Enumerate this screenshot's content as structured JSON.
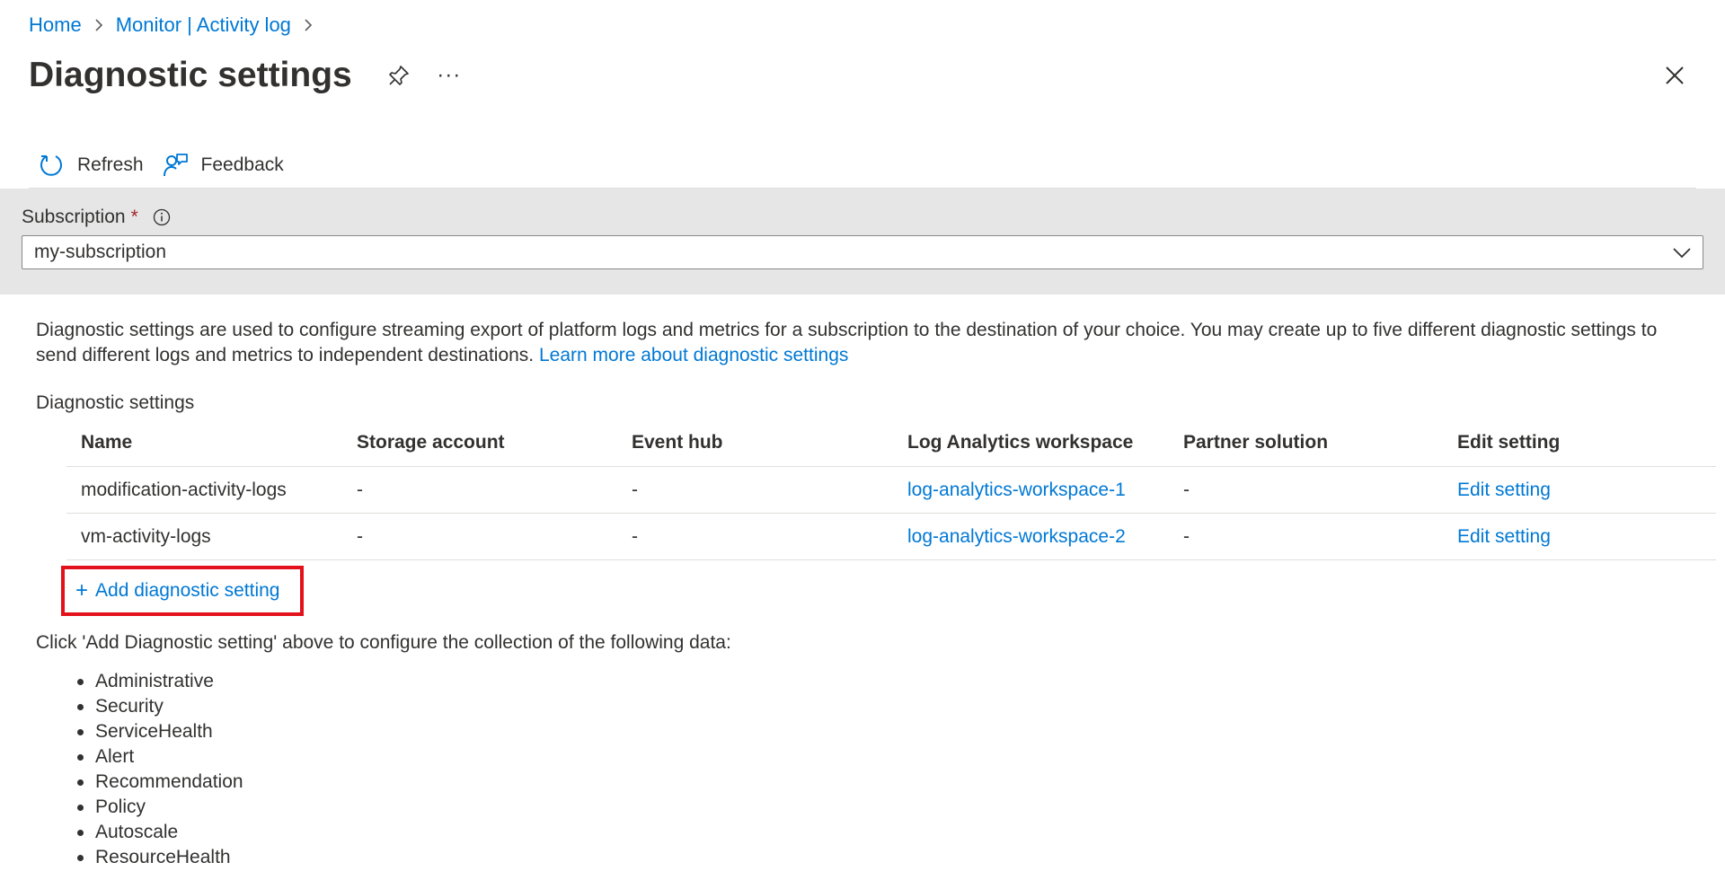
{
  "breadcrumb": {
    "home": "Home",
    "monitor": "Monitor | Activity log"
  },
  "page": {
    "title": "Diagnostic settings",
    "more": "···"
  },
  "toolbar": {
    "refresh": "Refresh",
    "feedback": "Feedback"
  },
  "subscription": {
    "label": "Subscription",
    "required_mark": "*",
    "value": "my-subscription"
  },
  "description": {
    "text": "Diagnostic settings are used to configure streaming export of platform logs and metrics for a subscription to the destination of your choice. You may create up to five different diagnostic settings to send different logs and metrics to independent destinations.",
    "link": "Learn more about diagnostic settings"
  },
  "section_label": "Diagnostic settings",
  "table": {
    "columns": [
      "Name",
      "Storage account",
      "Event hub",
      "Log Analytics workspace",
      "Partner solution",
      "Edit setting"
    ],
    "rows": [
      {
        "name": "modification-activity-logs",
        "storage": "-",
        "eventhub": "-",
        "workspace": "log-analytics-workspace-1",
        "partner": "-",
        "edit": "Edit setting"
      },
      {
        "name": "vm-activity-logs",
        "storage": "-",
        "eventhub": "-",
        "workspace": "log-analytics-workspace-2",
        "partner": "-",
        "edit": "Edit setting"
      }
    ]
  },
  "add_button": {
    "icon": "+",
    "label": "Add diagnostic setting"
  },
  "click_text": "Click 'Add Diagnostic setting' above to configure the collection of the following data:",
  "data_categories": [
    "Administrative",
    "Security",
    "ServiceHealth",
    "Alert",
    "Recommendation",
    "Policy",
    "Autoscale",
    "ResourceHealth"
  ],
  "colors": {
    "link": "#0078d4",
    "highlight": "#e3111b",
    "panel": "#e6e6e6",
    "required": "#a4262c"
  }
}
